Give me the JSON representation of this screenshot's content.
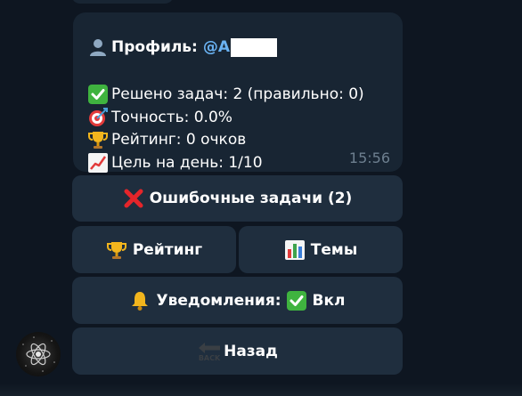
{
  "profile": {
    "title": "Профиль:",
    "username": "@A",
    "solved": "Решено задач: 2 (правильно: 0)",
    "accuracy": "Точность: 0.0%",
    "rating": "Рейтинг: 0 очков",
    "goal": "Цель на день: 1/10",
    "time": "15:56"
  },
  "keyboard": {
    "mistakes_label": "Ошибочные задачи (2)",
    "rating_label": "Рейтинг",
    "topics_label": "Темы",
    "notifications_label": "Уведомления:",
    "notifications_value": "Вкл",
    "back_label": "Назад",
    "back_icon_text": "BACK"
  },
  "icons": {
    "profile": "bust-in-silhouette-icon",
    "solved": "check-mark-icon",
    "accuracy": "direct-hit-icon",
    "rating": "trophy-icon",
    "goal": "chart-increasing-icon",
    "mistakes": "cross-mark-icon",
    "topics": "bar-chart-icon",
    "notifications": "bell-icon",
    "back": "back-arrow-icon"
  },
  "colors": {
    "background": "#0e1621",
    "bubble": "#182533",
    "button": "#1f2e3e",
    "username": "#6ab2f2",
    "timestamp": "#6d7f8f"
  }
}
